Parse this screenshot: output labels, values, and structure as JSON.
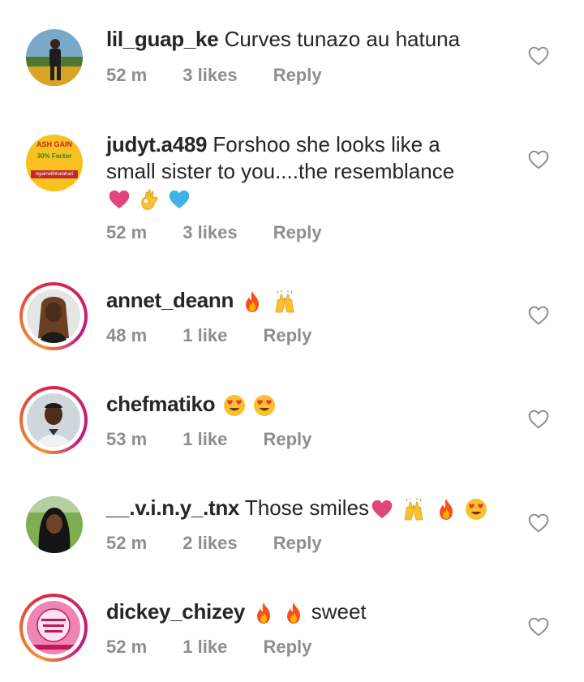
{
  "comments": [
    {
      "username": "lil_guap_ke",
      "text": "Curves tunazo au hatuna",
      "time": "52 m",
      "likes": "3 likes",
      "reply": "Reply",
      "avatar_icon": "man-outdoor-avatar"
    },
    {
      "username": "judyt.a489",
      "text": "Forshoo she looks like a",
      "text_line2": "small sister to you....the resemblance",
      "time": "52 m",
      "likes": "3 likes",
      "reply": "Reply",
      "avatar_icon": "cash-gain-logo-avatar",
      "avatar_text_top": "ASH GAIN",
      "avatar_text_mid": "30% Factor",
      "avatar_text_bottom": "#gainwithkalahari",
      "emojis": [
        "pink-heart",
        "ok-hand",
        "blue-heart"
      ]
    },
    {
      "username": "annet_deann",
      "text": "",
      "time": "48 m",
      "likes": "1 like",
      "reply": "Reply",
      "avatar_icon": "woman-braids-avatar",
      "emojis": [
        "fire",
        "raised-hands"
      ]
    },
    {
      "username": "chefmatiko",
      "text": "",
      "time": "53 m",
      "likes": "1 like",
      "reply": "Reply",
      "avatar_icon": "young-man-avatar",
      "emojis": [
        "heart-eyes",
        "heart-eyes"
      ]
    },
    {
      "username": "__.v.i.n.y_.tnx",
      "text": "Those smiles",
      "time": "52 m",
      "likes": "2 likes",
      "reply": "Reply",
      "avatar_icon": "woman-headscarf-avatar",
      "emojis": [
        "pink-heart",
        "raised-hands",
        "fire",
        "heart-eyes"
      ]
    },
    {
      "username": "dickey_chizey",
      "text": "sweet",
      "time": "52 m",
      "likes": "1 like",
      "reply": "Reply",
      "avatar_icon": "pink-badge-avatar",
      "emojis": [
        "fire",
        "fire"
      ]
    }
  ],
  "colors": {
    "text": "#262626",
    "meta": "#8e8e8e",
    "story_ring_start": "#f09433",
    "story_ring_end": "#bc1888"
  }
}
